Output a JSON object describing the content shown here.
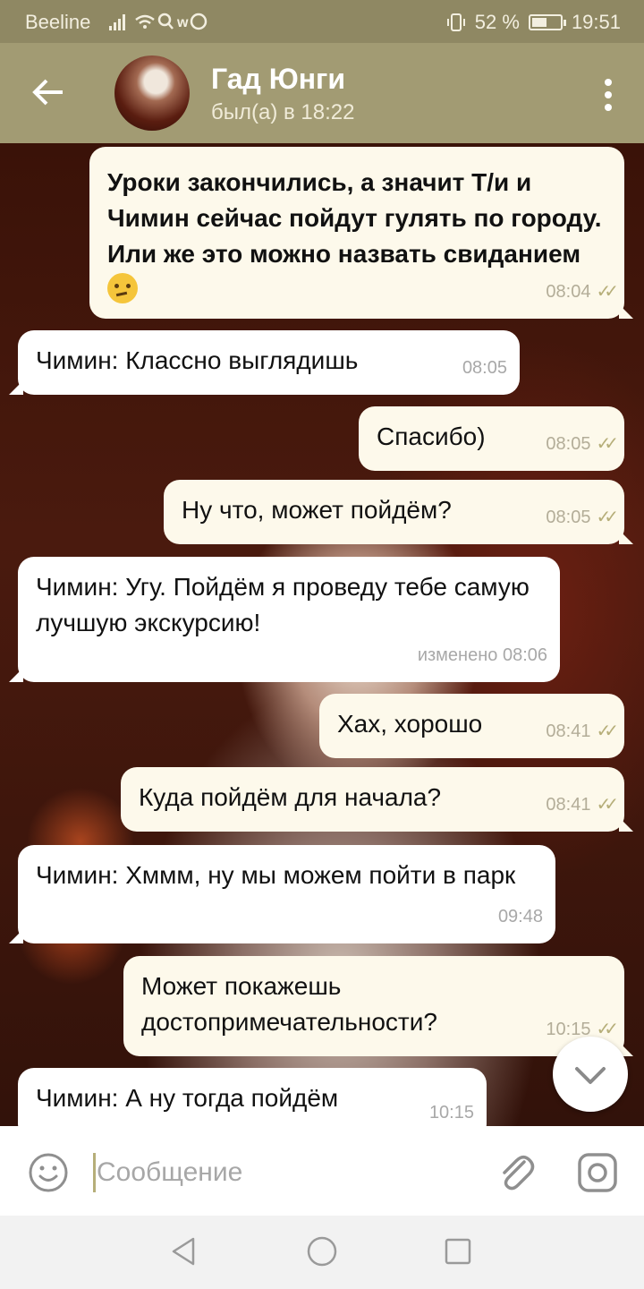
{
  "status": {
    "carrier": "Beeline",
    "battery": "52 %",
    "battery_level": 0.52,
    "time": "19:51"
  },
  "header": {
    "title": "Гад Юнги",
    "subtitle": "был(а) в 18:22"
  },
  "messages": [
    {
      "dir": "out",
      "text": "Уроки закончились, а значит Т/и и Чимин сейчас пойдут гулять по городу. Или же это можно назвать свиданием",
      "emoji": "thinking-face-icon",
      "time": "08:04"
    },
    {
      "dir": "in",
      "text": "Чимин: Классно выглядишь",
      "time": "08:05"
    },
    {
      "dir": "out",
      "text": "Спасибо)",
      "time": "08:05"
    },
    {
      "dir": "out",
      "text": "Ну что, может пойдём?",
      "time": "08:05"
    },
    {
      "dir": "in",
      "text": "Чимин: Угу. Пойдём я проведу тебе самую лучшую экскурсию!",
      "time": "изменено 08:06"
    },
    {
      "dir": "out",
      "text": "Хах, хорошо",
      "time": "08:41"
    },
    {
      "dir": "out",
      "text": "Куда пойдём для начала?",
      "time": "08:41"
    },
    {
      "dir": "in",
      "text": "Чимин: Хммм, ну мы можем пойти в парк",
      "time": "09:48"
    },
    {
      "dir": "out",
      "text": "Может покажешь достопримечательности?",
      "time": "10:15"
    },
    {
      "dir": "in",
      "text": "Чимин: А ну тогда пойдём",
      "time": "10:15"
    }
  ],
  "input": {
    "placeholder": "Сообщение"
  },
  "colors": {
    "header": "#a29b73",
    "statusbar": "#8f8863",
    "outgoing_bubble": "#fdf9eb",
    "incoming_bubble": "#ffffff",
    "read_checks": "#b6ae79"
  }
}
